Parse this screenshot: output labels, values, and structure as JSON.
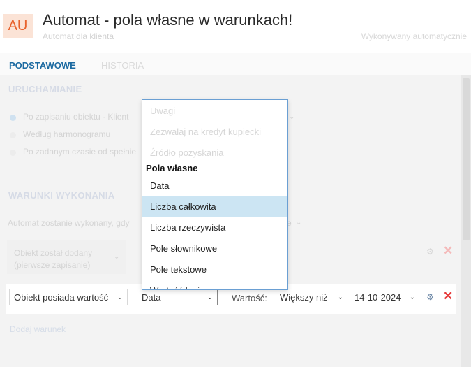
{
  "header": {
    "avatar": "AU",
    "title": "Automat - pola własne w warunkach!",
    "subtitle": "Automat dla klienta",
    "exec_mode": "Wykonywany automatycznie"
  },
  "tabs": [
    {
      "label": "PODSTAWOWE",
      "active": true
    },
    {
      "label": "HISTORIA",
      "active": false
    }
  ],
  "launch": {
    "title": "URUCHAMIANIE",
    "options": [
      {
        "label": "Po zapisaniu obiektu · Klient",
        "selected": true
      },
      {
        "label": "Według harmonogramu",
        "selected": false
      },
      {
        "label": "Po zadanym czasie od spełnie",
        "selected": false
      }
    ]
  },
  "conditions": {
    "title": "WARUNKI WYKONANIA",
    "intro_left": "Automat zostanie wykonany, gdy",
    "intro_right_select": "e",
    "row1": {
      "trigger_line1": "Obiekt został dodany",
      "trigger_line2": "(pierwsze zapisanie)"
    },
    "row2": {
      "condition": "Obiekt posiada wartość",
      "field": "Data",
      "value_label": "Wartość:",
      "operator": "Większy niż",
      "date": "14-10-2024"
    },
    "add_label": "Dodaj warunek"
  },
  "dropdown": {
    "faded_items": [
      "Uwagi",
      "Zezwalaj na kredyt kupiecki",
      "Źródło pozyskania"
    ],
    "group_label": "Pola własne",
    "items": [
      "Data",
      "Liczba całkowita",
      "Liczba rzeczywista",
      "Pole słownikowe",
      "Pole tekstowe",
      "Wartość logiczna"
    ],
    "highlighted": "Liczba całkowita"
  },
  "colors": {
    "accent": "#1c6aa1",
    "avatar_bg": "#fbe3d6",
    "avatar_text": "#e8622c",
    "delete_red": "#e63b3b",
    "highlight": "#cce5f3"
  },
  "icons": {
    "settings": "gear-icon",
    "delete": "close-icon",
    "chevron": "chevron-down-icon"
  }
}
